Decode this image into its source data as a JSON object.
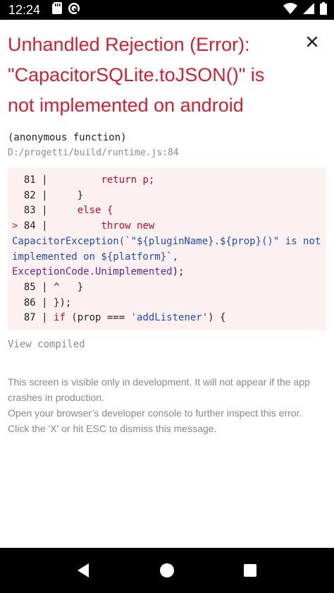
{
  "status_bar": {
    "time": "12:24",
    "left_icons": [
      "sd-card-icon",
      "vpn-icon"
    ],
    "right_icons": [
      "wifi-icon",
      "signal-icon",
      "battery-icon"
    ]
  },
  "error": {
    "title_line1": "Unhandled Rejection (Error):",
    "title_line2": "\"CapacitorSQLite.toJSON()\" is",
    "title_line3": "not implemented on android",
    "close_label": "×",
    "frame_function": "(anonymous function)",
    "frame_file": "D:/progetti/build/runtime.js:84"
  },
  "code": {
    "l81_no": "  81 | ",
    "l81_code": "        return p;",
    "l82_no": "  82 | ",
    "l82_code": "    }",
    "l83_no": "  83 | ",
    "l83_code": "    else {",
    "l84_marker": "> ",
    "l84_no": "84 | ",
    "l84_kw": "        throw new",
    "l84_fn": "CapacitorException",
    "l84_str": "(`\"${pluginName}.${prop}()\" is not implemented on ${platform}`,",
    "l84_ec": "ExceptionCode.Unimplemented",
    "l84_end": ");",
    "l85_no": "  85 | ",
    "l85_code": "^   }",
    "l86_no": "  86 | ",
    "l86_code": "});",
    "l87_no": "  87 | ",
    "l87_kw": "if",
    "l87_mid": " (prop === ",
    "l87_str": "'addListener'",
    "l87_end": ") {"
  },
  "view_compiled_label": "View compiled",
  "footer": {
    "line1": "This screen is visible only in development. It will not appear if the app crashes in production.",
    "line2": "Open your browser’s developer console to further inspect this error.",
    "line3": "Click the 'X' or hit ESC to dismiss this message."
  },
  "nav": {
    "back": "back-icon",
    "home": "home-icon",
    "recents": "recents-icon"
  },
  "colors": {
    "title_red": "#d32030",
    "code_bg": "#fcf0f1",
    "muted": "#878787"
  }
}
